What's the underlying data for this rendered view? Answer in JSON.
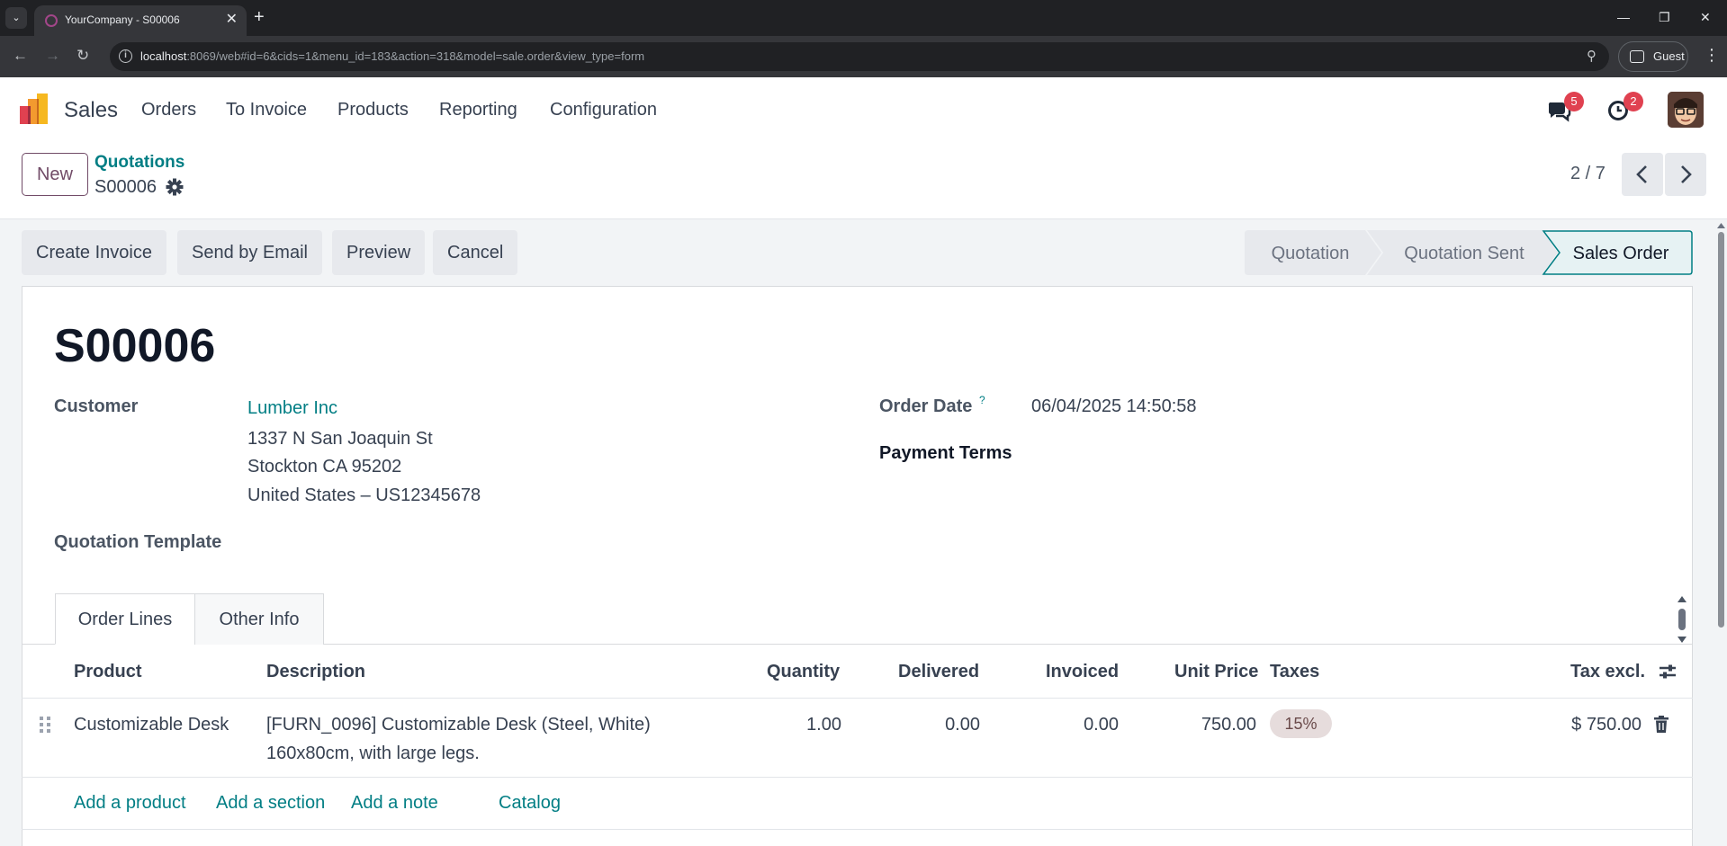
{
  "browser": {
    "tab_title": "YourCompany - S00006",
    "url_host": "localhost",
    "url_rest": ":8069/web#id=6&cids=1&menu_id=183&action=318&model=sale.order&view_type=form",
    "profile_label": "Guest"
  },
  "navbar": {
    "app_name": "Sales",
    "menus": [
      "Orders",
      "To Invoice",
      "Products",
      "Reporting",
      "Configuration"
    ],
    "messages_count": "5",
    "activities_count": "2"
  },
  "control": {
    "new_label": "New",
    "breadcrumb_parent": "Quotations",
    "breadcrumb_current": "S00006",
    "pager": "2 / 7"
  },
  "actions": [
    "Create Invoice",
    "Send by Email",
    "Preview",
    "Cancel"
  ],
  "status_steps": {
    "items": [
      "Quotation",
      "Quotation Sent",
      "Sales Order"
    ],
    "active": "Sales Order"
  },
  "form": {
    "name": "S00006",
    "customer_label": "Customer",
    "customer_name": "Lumber Inc",
    "customer_address": [
      "1337 N San Joaquin St",
      "Stockton CA 95202",
      "United States – US12345678"
    ],
    "template_label": "Quotation Template",
    "order_date_label": "Order Date",
    "order_date_help": "?",
    "order_date_value": "06/04/2025 14:50:58",
    "payment_terms_label": "Payment Terms"
  },
  "notebook": {
    "tabs": [
      "Order Lines",
      "Other Info"
    ],
    "active": "Order Lines"
  },
  "order_lines": {
    "headers": {
      "product": "Product",
      "description": "Description",
      "quantity": "Quantity",
      "delivered": "Delivered",
      "invoiced": "Invoiced",
      "unit_price": "Unit Price",
      "taxes": "Taxes",
      "subtotal": "Tax excl."
    },
    "rows": [
      {
        "product": "Customizable Desk",
        "description_line1": "[FURN_0096] Customizable Desk (Steel, White)",
        "description_line2": "160x80cm, with large legs.",
        "quantity": "1.00",
        "delivered": "0.00",
        "invoiced": "0.00",
        "unit_price": "750.00",
        "tax": "15%",
        "subtotal": "$ 750.00"
      }
    ],
    "add_links": [
      "Add a product",
      "Add a section",
      "Add a note",
      "Catalog"
    ]
  },
  "colors": {
    "brand": "#714b67",
    "link": "#017e84",
    "badge": "#e04150"
  }
}
